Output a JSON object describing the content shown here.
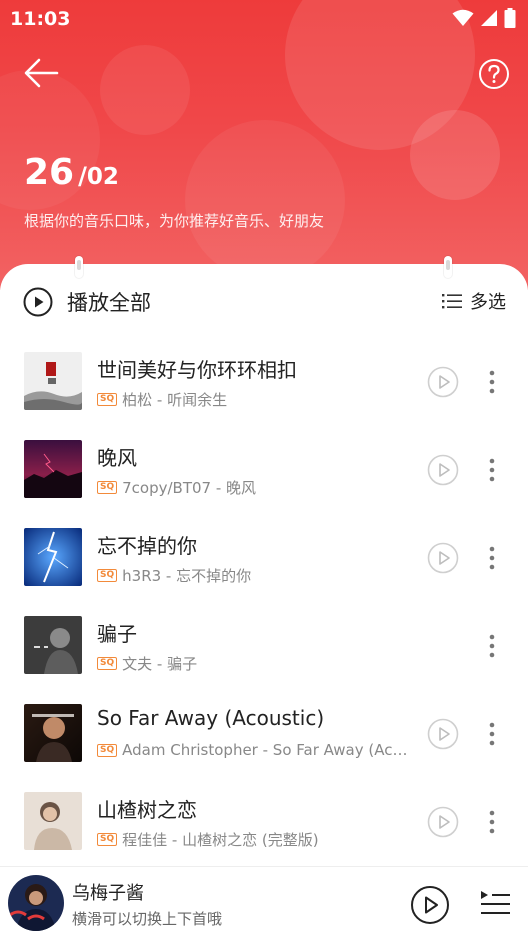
{
  "status_bar": {
    "time": "11:03"
  },
  "header": {
    "day": "26",
    "slash": "/",
    "month": "02",
    "subtitle": "根据你的音乐口味，为你推荐好音乐、好朋友"
  },
  "toolbar": {
    "play_all_label": "播放全部",
    "multi_select_label": "多选"
  },
  "songs": [
    {
      "title": "世间美好与你环环相扣",
      "quality": "SQ",
      "subtitle": "柏松 - 听闻余生",
      "has_mv": true
    },
    {
      "title": "晚风",
      "quality": "SQ",
      "subtitle": "7copy/BT07 - 晚风",
      "has_mv": true
    },
    {
      "title": "忘不掉的你",
      "quality": "SQ",
      "subtitle": "h3R3 - 忘不掉的你",
      "has_mv": true
    },
    {
      "title": "骗子",
      "quality": "SQ",
      "subtitle": "文夫 - 骗子",
      "has_mv": false
    },
    {
      "title": "So Far Away (Acoustic)",
      "quality": "SQ",
      "subtitle": "Adam Christopher - So Far Away (Acoustic)",
      "has_mv": true
    },
    {
      "title": "山楂树之恋",
      "quality": "SQ",
      "subtitle": "程佳佳 - 山楂树之恋 (完整版)",
      "has_mv": true
    }
  ],
  "mini_player": {
    "title": "乌梅子酱",
    "hint": "横滑可以切换上下首哦"
  },
  "colors": {
    "header_red": "#ee3b3b",
    "quality_badge": "#f28a3a"
  }
}
